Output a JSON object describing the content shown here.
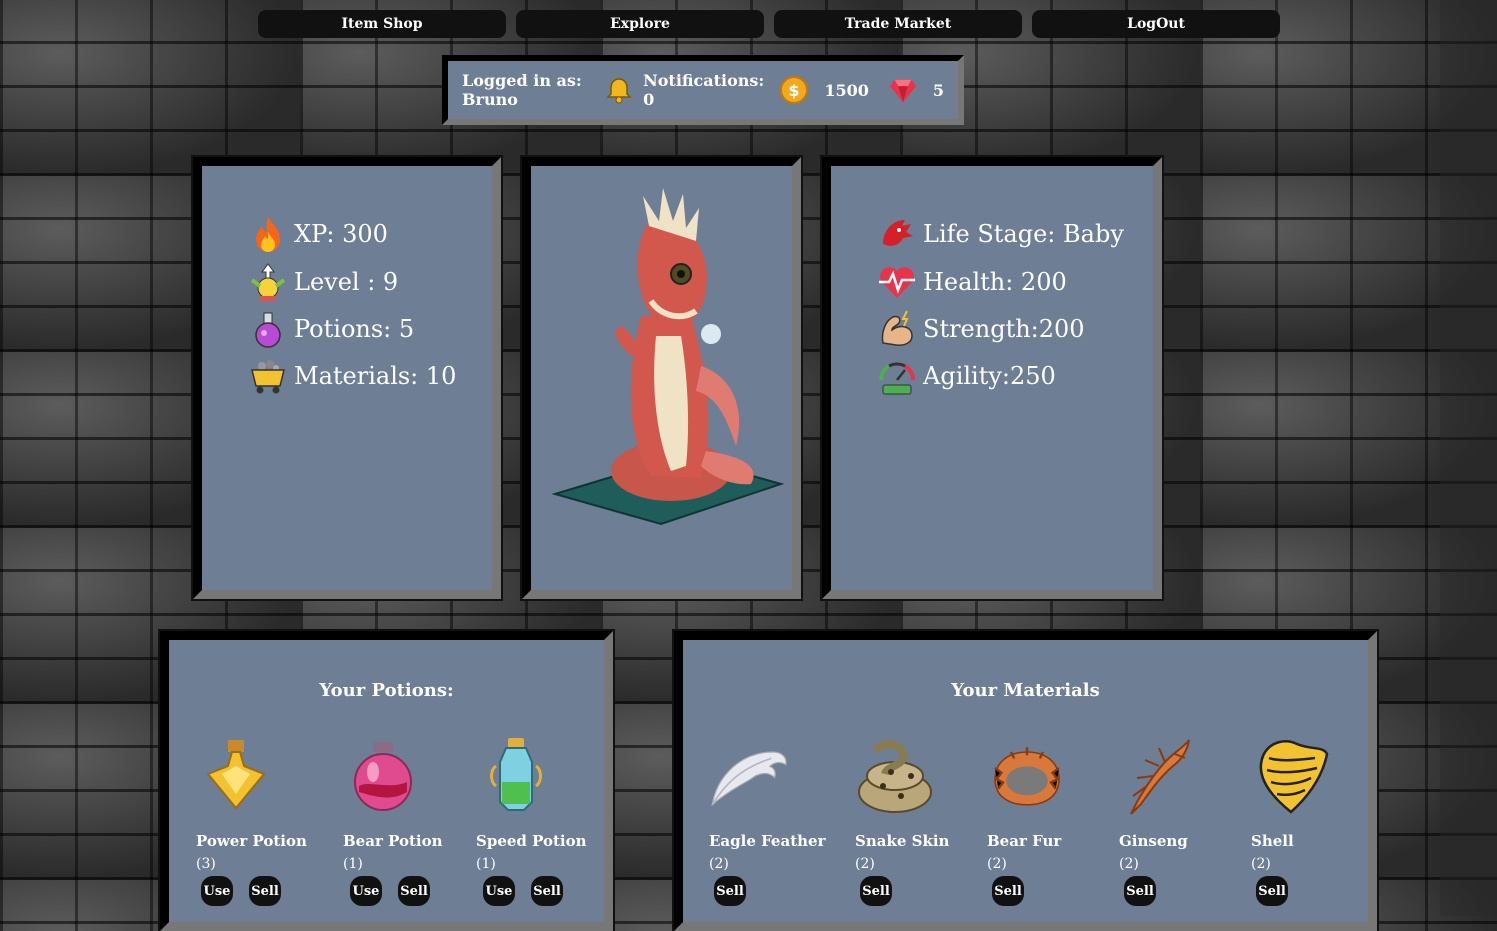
{
  "nav": {
    "item_shop": "Item Shop",
    "explore": "Explore",
    "trade_market": "Trade Market",
    "logout": "LogOut"
  },
  "status": {
    "logged_in": "Logged in as: Bruno",
    "notifications": "Notifications: 0",
    "coins": "1500",
    "gems": "5",
    "icons": [
      "bell-icon",
      "coin-icon",
      "gem-icon"
    ]
  },
  "stats": {
    "xp": "XP: 300",
    "level": "Level : 9",
    "potions": "Potions: 5",
    "materials": "Materials: 10"
  },
  "life": {
    "stage": "Life Stage: Baby",
    "health": "Health: 200",
    "strength": "Strength:200",
    "agility": "Agility:250"
  },
  "potions": {
    "title": "Your Potions:",
    "use_label": "Use",
    "sell_label": "Sell",
    "items": [
      {
        "name": "Power Potion",
        "qty": "(3)"
      },
      {
        "name": "Bear Potion",
        "qty": "(1)"
      },
      {
        "name": "Speed Potion",
        "qty": "(1)"
      }
    ]
  },
  "materials": {
    "title": "Your Materials",
    "sell_label": "Sell",
    "items": [
      {
        "name": "Eagle Feather",
        "qty": "(2)"
      },
      {
        "name": "Snake Skin",
        "qty": "(2)"
      },
      {
        "name": "Bear Fur",
        "qty": "(2)"
      },
      {
        "name": "Ginseng",
        "qty": "(2)"
      },
      {
        "name": "Shell",
        "qty": "(2)"
      }
    ]
  },
  "colors": {
    "panel": "#6e7e94",
    "button": "#111111"
  }
}
